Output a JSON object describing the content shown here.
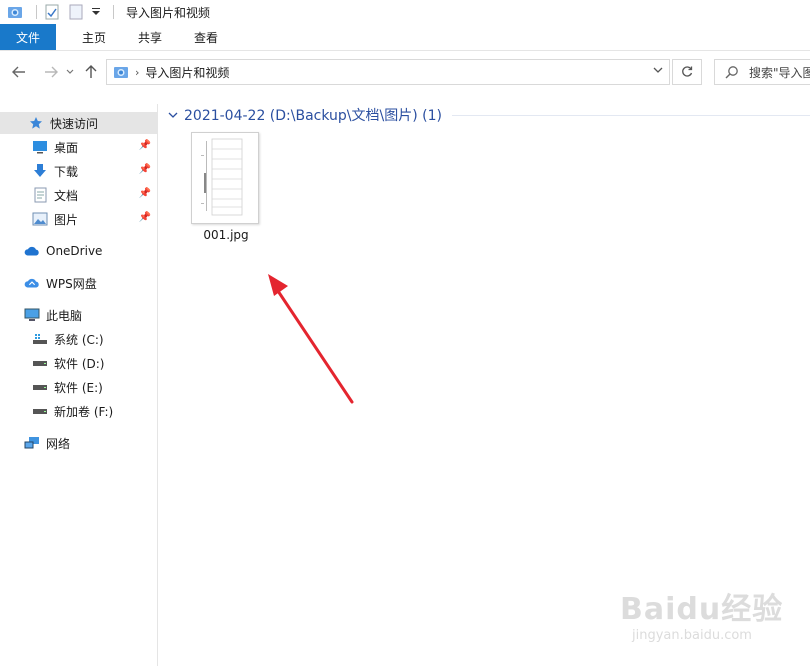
{
  "window": {
    "title": "导入图片和视频"
  },
  "ribbon": {
    "tabs": [
      {
        "label": "文件",
        "active": true
      },
      {
        "label": "主页"
      },
      {
        "label": "共享"
      },
      {
        "label": "查看"
      }
    ]
  },
  "address_bar": {
    "path": "导入图片和视频"
  },
  "search": {
    "placeholder": "搜索\"导入图"
  },
  "nav_pane": {
    "quick_access": {
      "label": "快速访问",
      "icon": "star-icon"
    },
    "pinned": [
      {
        "label": "桌面",
        "icon": "desktop-icon"
      },
      {
        "label": "下载",
        "icon": "download-icon"
      },
      {
        "label": "文档",
        "icon": "document-icon"
      },
      {
        "label": "图片",
        "icon": "picture-icon"
      }
    ],
    "onedrive": {
      "label": "OneDrive",
      "icon": "cloud-icon"
    },
    "wps": {
      "label": "WPS网盘",
      "icon": "wps-cloud-icon"
    },
    "this_pc": {
      "label": "此电脑",
      "icon": "computer-icon"
    },
    "drives": [
      {
        "label": "系统 (C:)",
        "icon": "system-drive-icon"
      },
      {
        "label": "软件 (D:)",
        "icon": "drive-icon"
      },
      {
        "label": "软件 (E:)",
        "icon": "drive-icon"
      },
      {
        "label": "新加卷 (F:)",
        "icon": "drive-icon"
      }
    ],
    "network": {
      "label": "网络",
      "icon": "network-icon"
    }
  },
  "content": {
    "group_header": "2021-04-22 (D:\\Backup\\文档\\图片) (1)",
    "files": [
      {
        "name": "001.jpg"
      }
    ]
  },
  "watermark": {
    "brand": "Baidu经验",
    "url": "jingyan.baidu.com"
  },
  "colors": {
    "file_tab": "#1979ca",
    "group_header": "#2b4fa0",
    "arrow": "#e4252f",
    "selection": "#e5e5e5"
  }
}
